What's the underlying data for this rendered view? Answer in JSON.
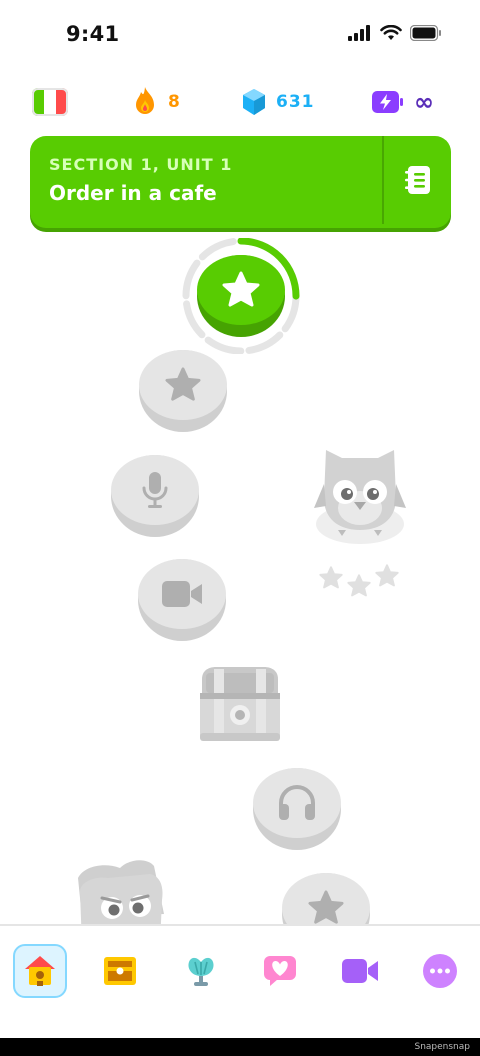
{
  "status_bar": {
    "time": "9:41"
  },
  "stats": {
    "language_flag": "italy-flag-icon",
    "streak": "8",
    "gems": "631",
    "energy": "∞"
  },
  "unit_banner": {
    "section": "SECTION 1, UNIT 1",
    "title": "Order in a cafe",
    "guide_icon": "guidebook-icon"
  },
  "path": {
    "nodes": [
      {
        "icon": "star-icon",
        "state": "active",
        "progress": 0.25
      },
      {
        "icon": "star-icon",
        "state": "locked"
      },
      {
        "icon": "microphone-icon",
        "state": "locked"
      },
      {
        "icon": "video-camera-icon",
        "state": "locked"
      },
      {
        "icon": "treasure-chest-icon",
        "state": "locked"
      },
      {
        "icon": "headphones-icon",
        "state": "locked"
      },
      {
        "icon": "star-icon",
        "state": "locked"
      }
    ],
    "character_stars": 3
  },
  "bottom_nav": {
    "items": [
      {
        "icon": "home-icon",
        "active": true
      },
      {
        "icon": "treasure-chest-icon",
        "active": false
      },
      {
        "icon": "shell-icon",
        "active": false
      },
      {
        "icon": "heart-chat-icon",
        "active": false
      },
      {
        "icon": "video-icon",
        "active": false
      },
      {
        "icon": "more-icon",
        "active": false
      }
    ]
  },
  "watermark": "Snapensnap",
  "colors": {
    "green": "#58cc02",
    "green_dark": "#46a302",
    "streak_orange": "#ff9600",
    "gem_blue": "#1cb0f6",
    "energy_purple": "#8b3dff",
    "locked_gray": "#e5e5e5"
  }
}
